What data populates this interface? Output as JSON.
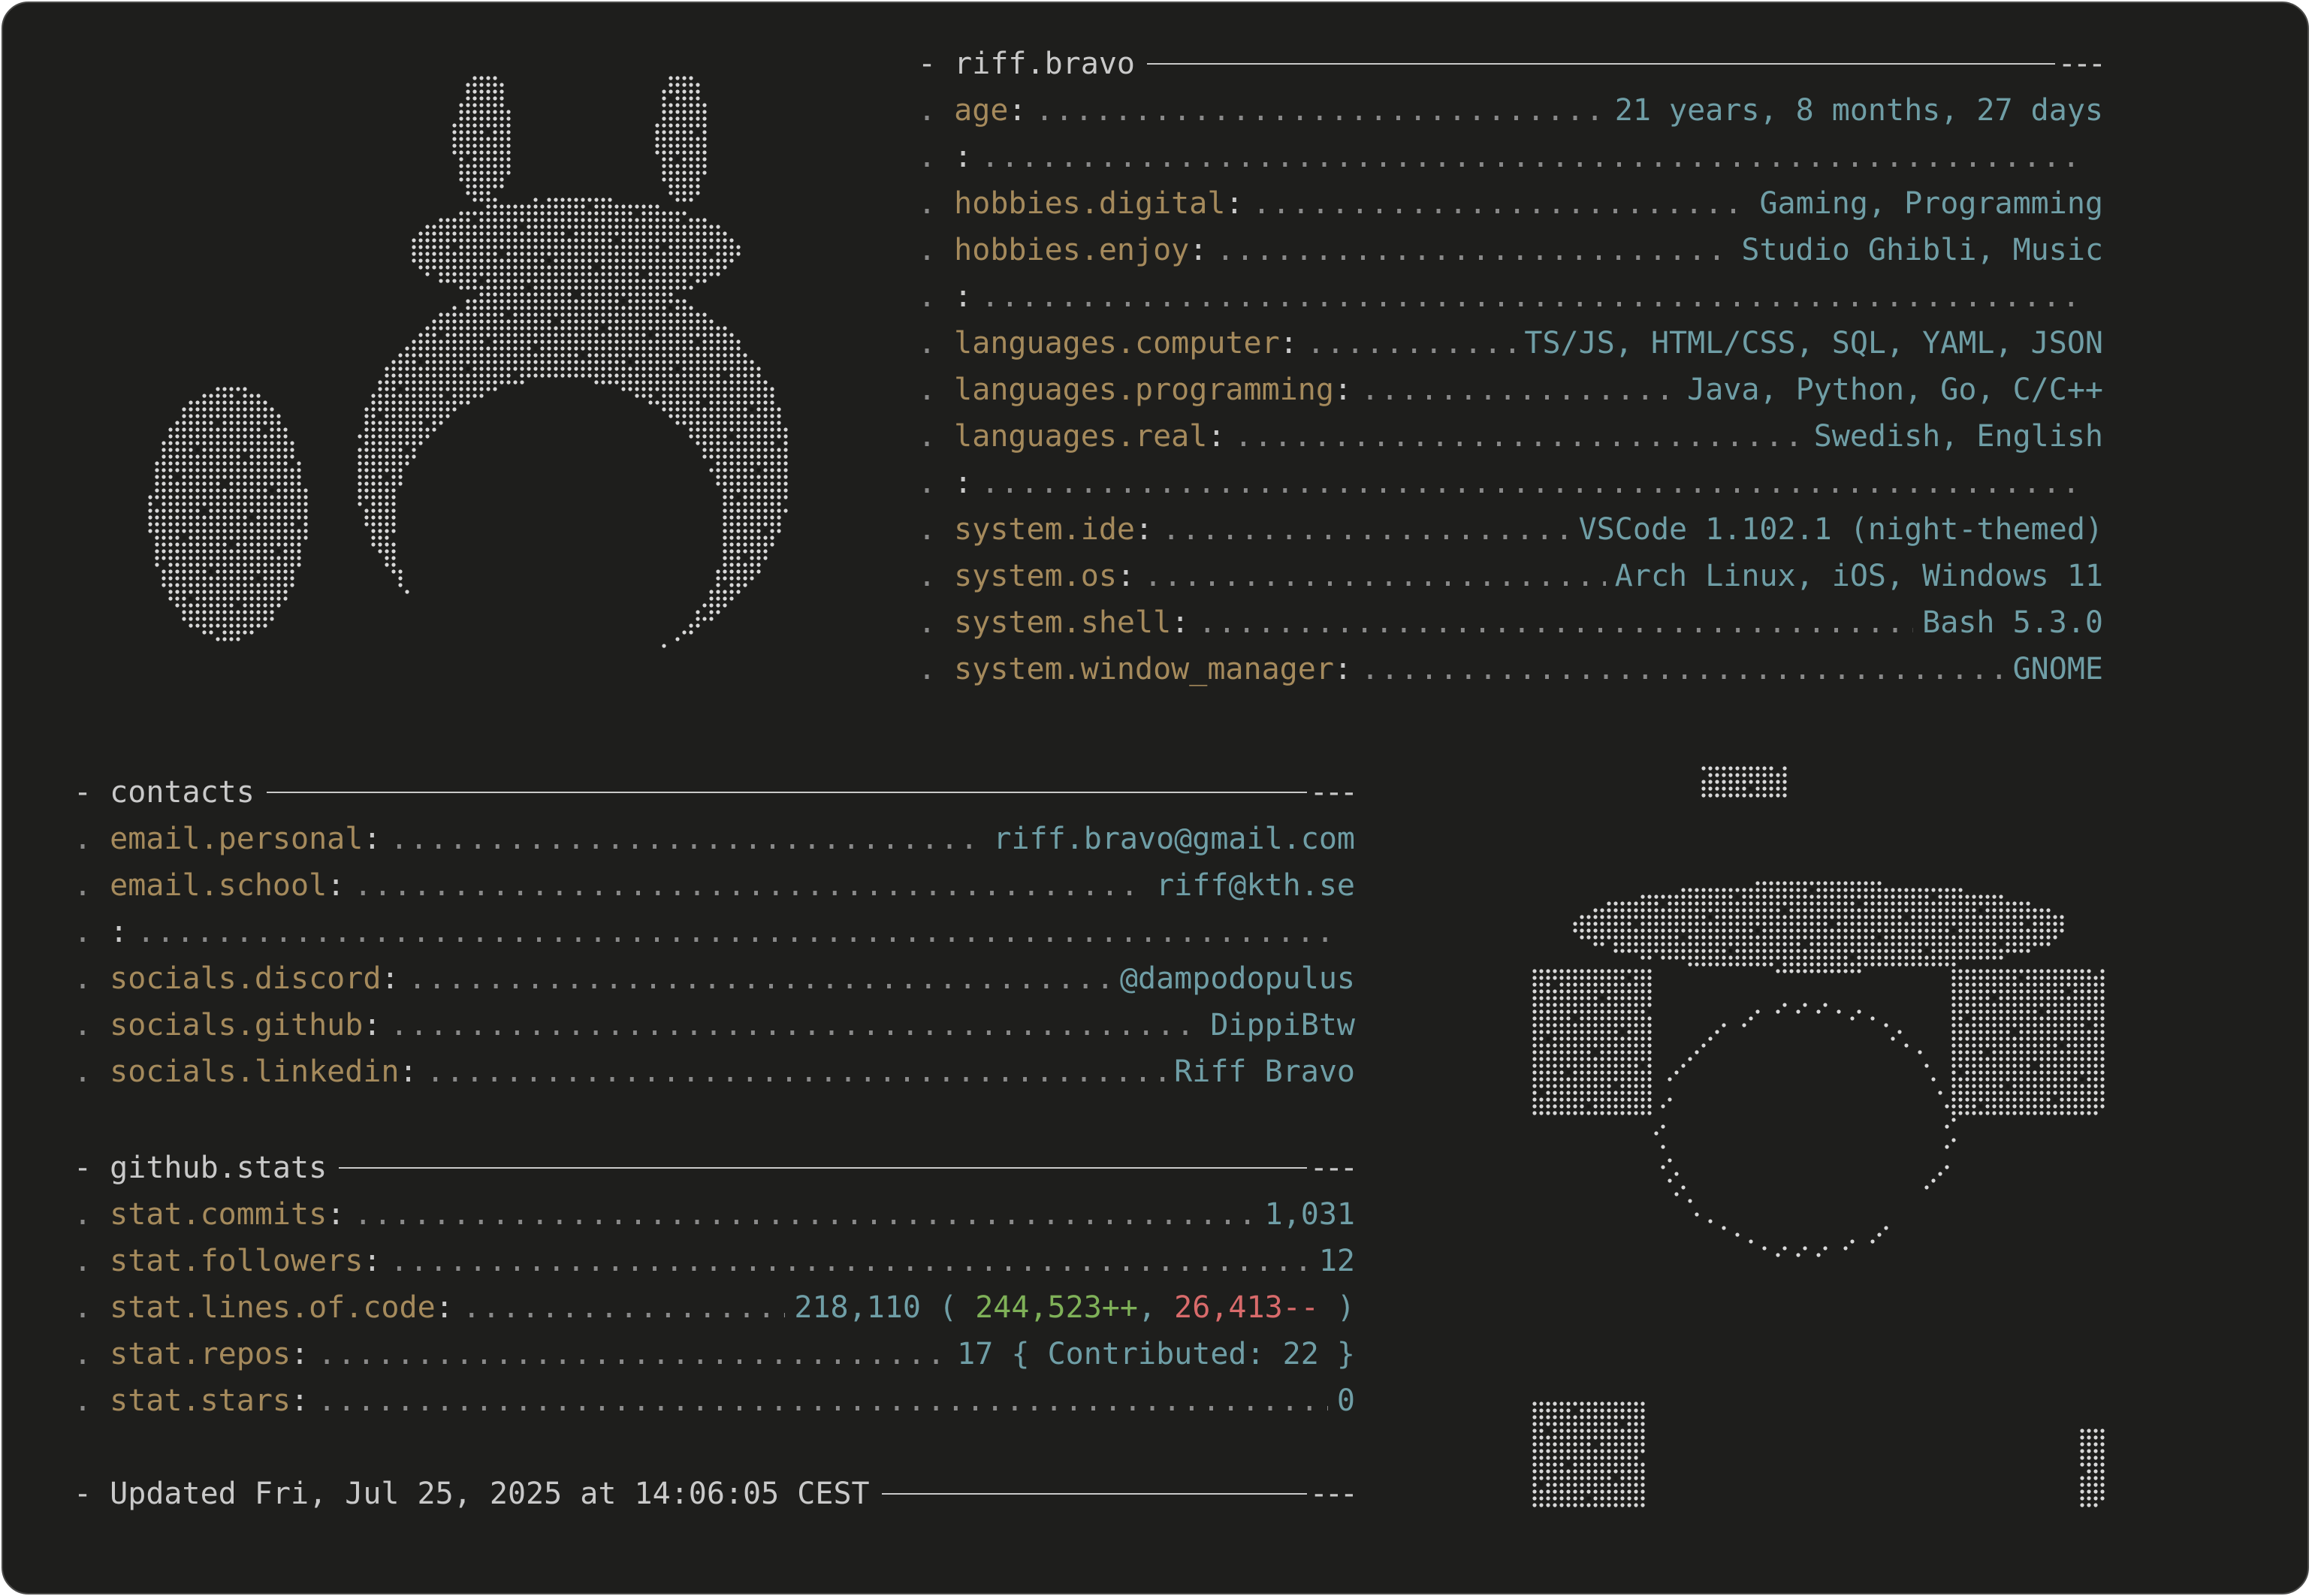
{
  "profile": {
    "header": "- riff.bravo",
    "rows": [
      {
        "label": "age",
        "value": "21 years, 8 months, 27 days"
      },
      {
        "separator": true
      },
      {
        "label": "hobbies.digital",
        "value": "Gaming, Programming"
      },
      {
        "label": "hobbies.enjoy",
        "value": "Studio Ghibli, Music"
      },
      {
        "separator": true
      },
      {
        "label": "languages.computer",
        "value": "TS/JS, HTML/CSS, SQL, YAML, JSON"
      },
      {
        "label": "languages.programming",
        "value": "Java, Python, Go, C/C++"
      },
      {
        "label": "languages.real",
        "value": "Swedish, English"
      },
      {
        "separator": true
      },
      {
        "label": "system.ide",
        "value": "VSCode 1.102.1 (night-themed)"
      },
      {
        "label": "system.os",
        "value": "Arch Linux, iOS, Windows 11"
      },
      {
        "label": "system.shell",
        "value": "Bash 5.3.0"
      },
      {
        "label": "system.window_manager",
        "value": "GNOME"
      }
    ]
  },
  "contacts": {
    "header": "- contacts",
    "rows": [
      {
        "label": "email.personal",
        "value": "riff.bravo@gmail.com"
      },
      {
        "label": "email.school",
        "value": "riff@kth.se"
      },
      {
        "separator": true
      },
      {
        "label": "socials.discord",
        "value": "@dampodopulus"
      },
      {
        "label": "socials.github",
        "value": "DippiBtw"
      },
      {
        "label": "socials.linkedin",
        "value": "Riff Bravo"
      }
    ]
  },
  "github_stats": {
    "header": "- github.stats",
    "commits_label": "stat.commits",
    "commits_value": "1,031",
    "followers_label": "stat.followers",
    "followers_value": "12",
    "loc_label": "stat.lines.of.code",
    "loc_total": "218,110",
    "loc_open": "(",
    "loc_added": "244,523++",
    "loc_comma": ",",
    "loc_removed": "26,413--",
    "loc_close": ")",
    "repos_label": "stat.repos",
    "repos_value": "17",
    "repos_contrib": "{ Contributed: 22 }",
    "stars_label": "stat.stars",
    "stars_value": "0"
  },
  "footer": {
    "updated": "- Updated Fri, Jul 25, 2025 at 14:06:05 CEST"
  },
  "colors": {
    "background": "#1e1e1c",
    "label": "#a58a5c",
    "value": "#6f9ea6",
    "added": "#7fb158",
    "removed": "#d96b6b",
    "text": "#c9c9c9"
  },
  "art": {
    "top_left": "totoro-braille-art",
    "bottom_right": "kiki-braille-art"
  }
}
